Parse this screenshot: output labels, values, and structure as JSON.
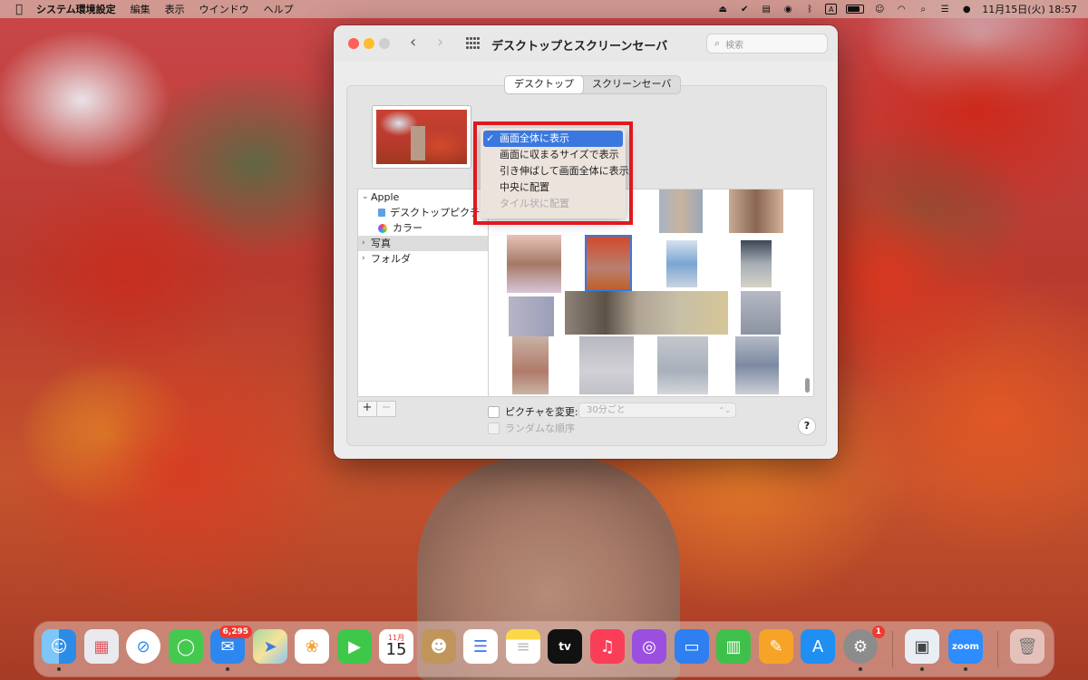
{
  "menubar": {
    "app_name": "システム環境設定",
    "menus": [
      "編集",
      "表示",
      "ウインドウ",
      "ヘルプ"
    ],
    "input_indicator": "A",
    "clock": "11月15日(火)  18:57"
  },
  "window": {
    "title": "デスクトップとスクリーンセーバ",
    "search_placeholder": "検索",
    "tabs": [
      "デスクトップ",
      "スクリーンセーバ"
    ],
    "active_tab": "デスクトップ"
  },
  "sidebar": {
    "items": [
      {
        "label": "Apple",
        "expanded": true
      },
      {
        "label": "デスクトップピクチャ",
        "icon": "folder-icon"
      },
      {
        "label": "カラー",
        "icon": "color-wheel-icon"
      },
      {
        "label": "写真",
        "selected": true
      },
      {
        "label": "フォルダ"
      }
    ]
  },
  "popup_menu": {
    "items": [
      {
        "label": "画面全体に表示",
        "checked": true
      },
      {
        "label": "画面に収まるサイズで表示"
      },
      {
        "label": "引き伸ばして画面全体に表示"
      },
      {
        "label": "中央に配置"
      },
      {
        "label": "タイル状に配置",
        "disabled": true
      }
    ],
    "check_mark": "✓"
  },
  "options": {
    "change_picture_label": "ピクチャを変更:",
    "interval_value": "30分ごと",
    "random_order_label": "ランダムな順序",
    "add": "+",
    "remove": "−",
    "help": "?"
  },
  "dock": {
    "apps": [
      {
        "name": "Finder"
      },
      {
        "name": "Launchpad"
      },
      {
        "name": "Safari"
      },
      {
        "name": "メッセージ"
      },
      {
        "name": "メール",
        "badge": "6,295"
      },
      {
        "name": "マップ"
      },
      {
        "name": "写真"
      },
      {
        "name": "FaceTime"
      },
      {
        "name": "カレンダー",
        "month": "11月",
        "day": "15"
      },
      {
        "name": "連絡先"
      },
      {
        "name": "リマインダー"
      },
      {
        "name": "メモ"
      },
      {
        "name": "TV",
        "label": "tv"
      },
      {
        "name": "ミュージック"
      },
      {
        "name": "Podcast"
      },
      {
        "name": "Keynote"
      },
      {
        "name": "Numbers"
      },
      {
        "name": "Pages"
      },
      {
        "name": "App Store"
      },
      {
        "name": "システム環境設定",
        "badge": "1"
      },
      {
        "name": "プレビュー"
      },
      {
        "name": "zoom",
        "label": "zoom"
      },
      {
        "name": "ゴミ箱"
      }
    ]
  },
  "colors": {
    "highlight_box": "#e0191f",
    "menu_selection": "#3a78e0",
    "traffic_red": "#fe5f57",
    "traffic_yellow": "#febc2e"
  }
}
